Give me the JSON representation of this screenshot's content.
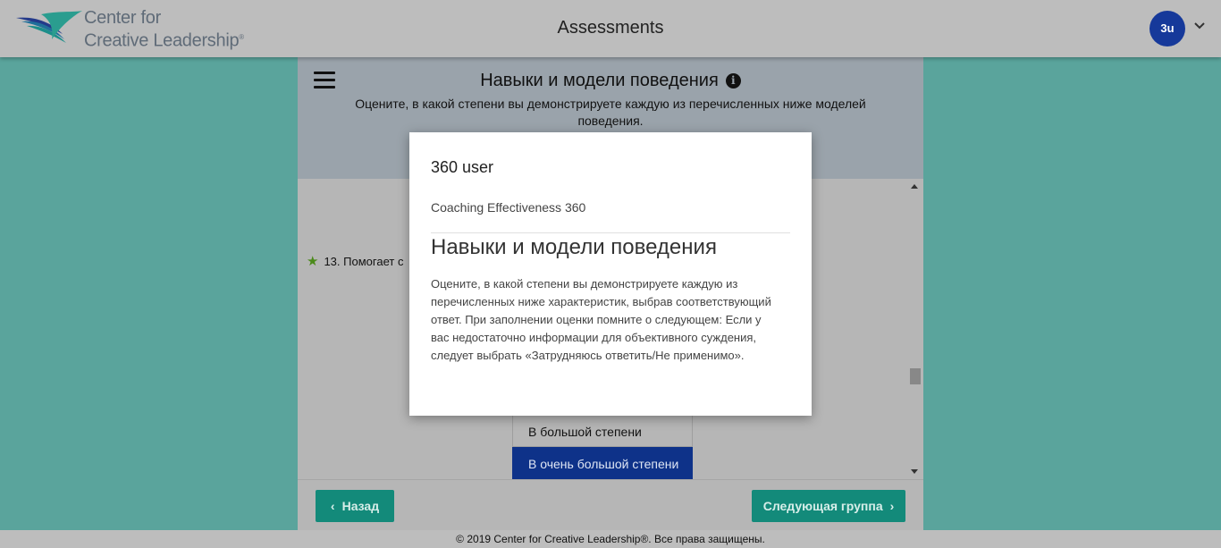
{
  "header": {
    "logo_line1": "Center for",
    "logo_line2": "Creative Leadership",
    "logo_mark": "®",
    "app_title": "Assessments",
    "avatar_initials": "3u"
  },
  "section": {
    "title": "Навыки и модели поведения",
    "subtitle": "Оцените, в какой степени вы демонстрируете каждую из перечисленных ниже моделей поведения."
  },
  "question": {
    "number_text": "13.",
    "text_visible": "Помогает с"
  },
  "options": [
    {
      "label": "В большой степени",
      "selected": false
    },
    {
      "label": "В очень большой степени",
      "selected": true
    }
  ],
  "nav": {
    "back_label": "Назад",
    "next_label": "Следующая группа"
  },
  "footer": {
    "copyright": "© 2019 Center for Creative Leadership®. Все права защищены."
  },
  "modal": {
    "user": "360 user",
    "product": "Coaching Effectiveness 360",
    "title": "Навыки и модели поведения",
    "body": "Оцените, в какой степени вы демонстрируете каждую из перечисленных ниже характеристик, выбрав соответствующий ответ. При заполнении оценки помните о следующем: Если у вас недостаточно информации для объективного суждения, следует выбрать «Затрудняюсь ответить/Не применимо»."
  },
  "colors": {
    "page_bg": "#5aa49c",
    "accent_teal": "#138a7a",
    "selected_blue": "#0e3289",
    "avatar_blue": "#16399a"
  },
  "icons": [
    "ccl-logo-icon",
    "chevron-down-icon",
    "menu-icon",
    "info-icon",
    "star-icon",
    "chevron-left-icon",
    "chevron-right-icon"
  ]
}
